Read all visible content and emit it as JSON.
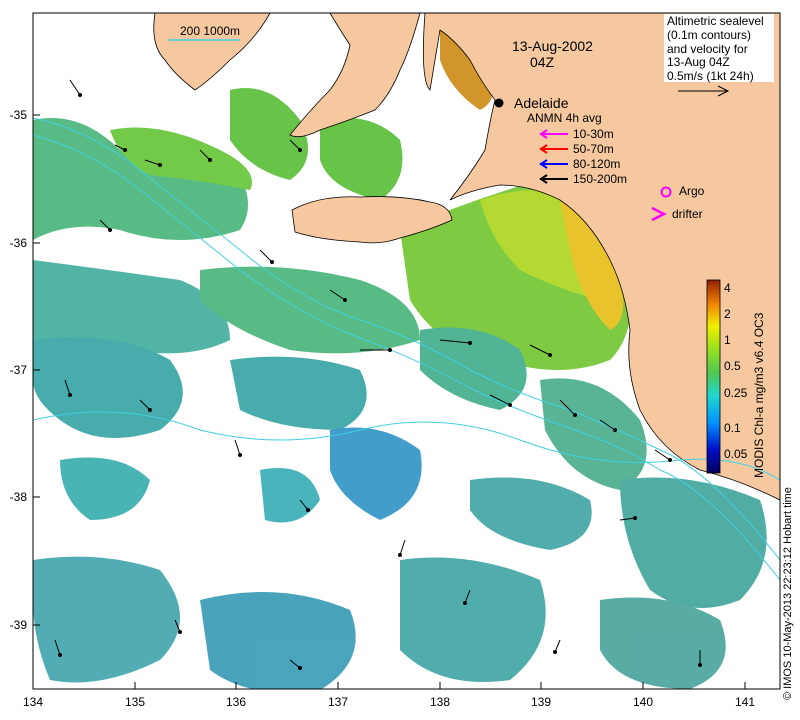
{
  "map": {
    "date": "13-Aug-2002",
    "time": "04Z",
    "city": "Adelaide",
    "depth_contours_label": "200  1000m",
    "lon_ticks": [
      "134",
      "135",
      "136",
      "137",
      "138",
      "139",
      "140",
      "141"
    ],
    "lat_ticks": [
      "-35",
      "-36",
      "-37",
      "-38",
      "-39"
    ],
    "lon_range": [
      134,
      141.3
    ],
    "lat_range": [
      -34.4,
      -39.5
    ],
    "sealevel_note": [
      "Altimetric sealevel",
      "(0.1m contours)",
      "and velocity for",
      "13-Aug 04Z",
      "0.5m/s (1kt 24h)"
    ],
    "anmn_title": "ANMN 4h avg",
    "anmn_legend": [
      {
        "label": "10-30m",
        "color": "#ff00ff"
      },
      {
        "label": "50-70m",
        "color": "#ff0000"
      },
      {
        "label": "80-120m",
        "color": "#0000ff"
      },
      {
        "label": "150-200m",
        "color": "#000000"
      }
    ],
    "argo_label": "Argo",
    "drifter_label": "drifter",
    "argo_color": "#ff00ff",
    "colorbar": {
      "label": "MODIS Chl-a mg/m3 v6.4 OC3",
      "ticks": [
        "4",
        "2",
        "1",
        "0.5",
        "0.25",
        "0.1",
        "0.05"
      ]
    },
    "credit": "© IMOS 10-May-2013 22:23:12 Hobart time",
    "colors": {
      "land": "#f5c8a0",
      "contour": "#40d0e0",
      "coast": "#000000"
    }
  }
}
